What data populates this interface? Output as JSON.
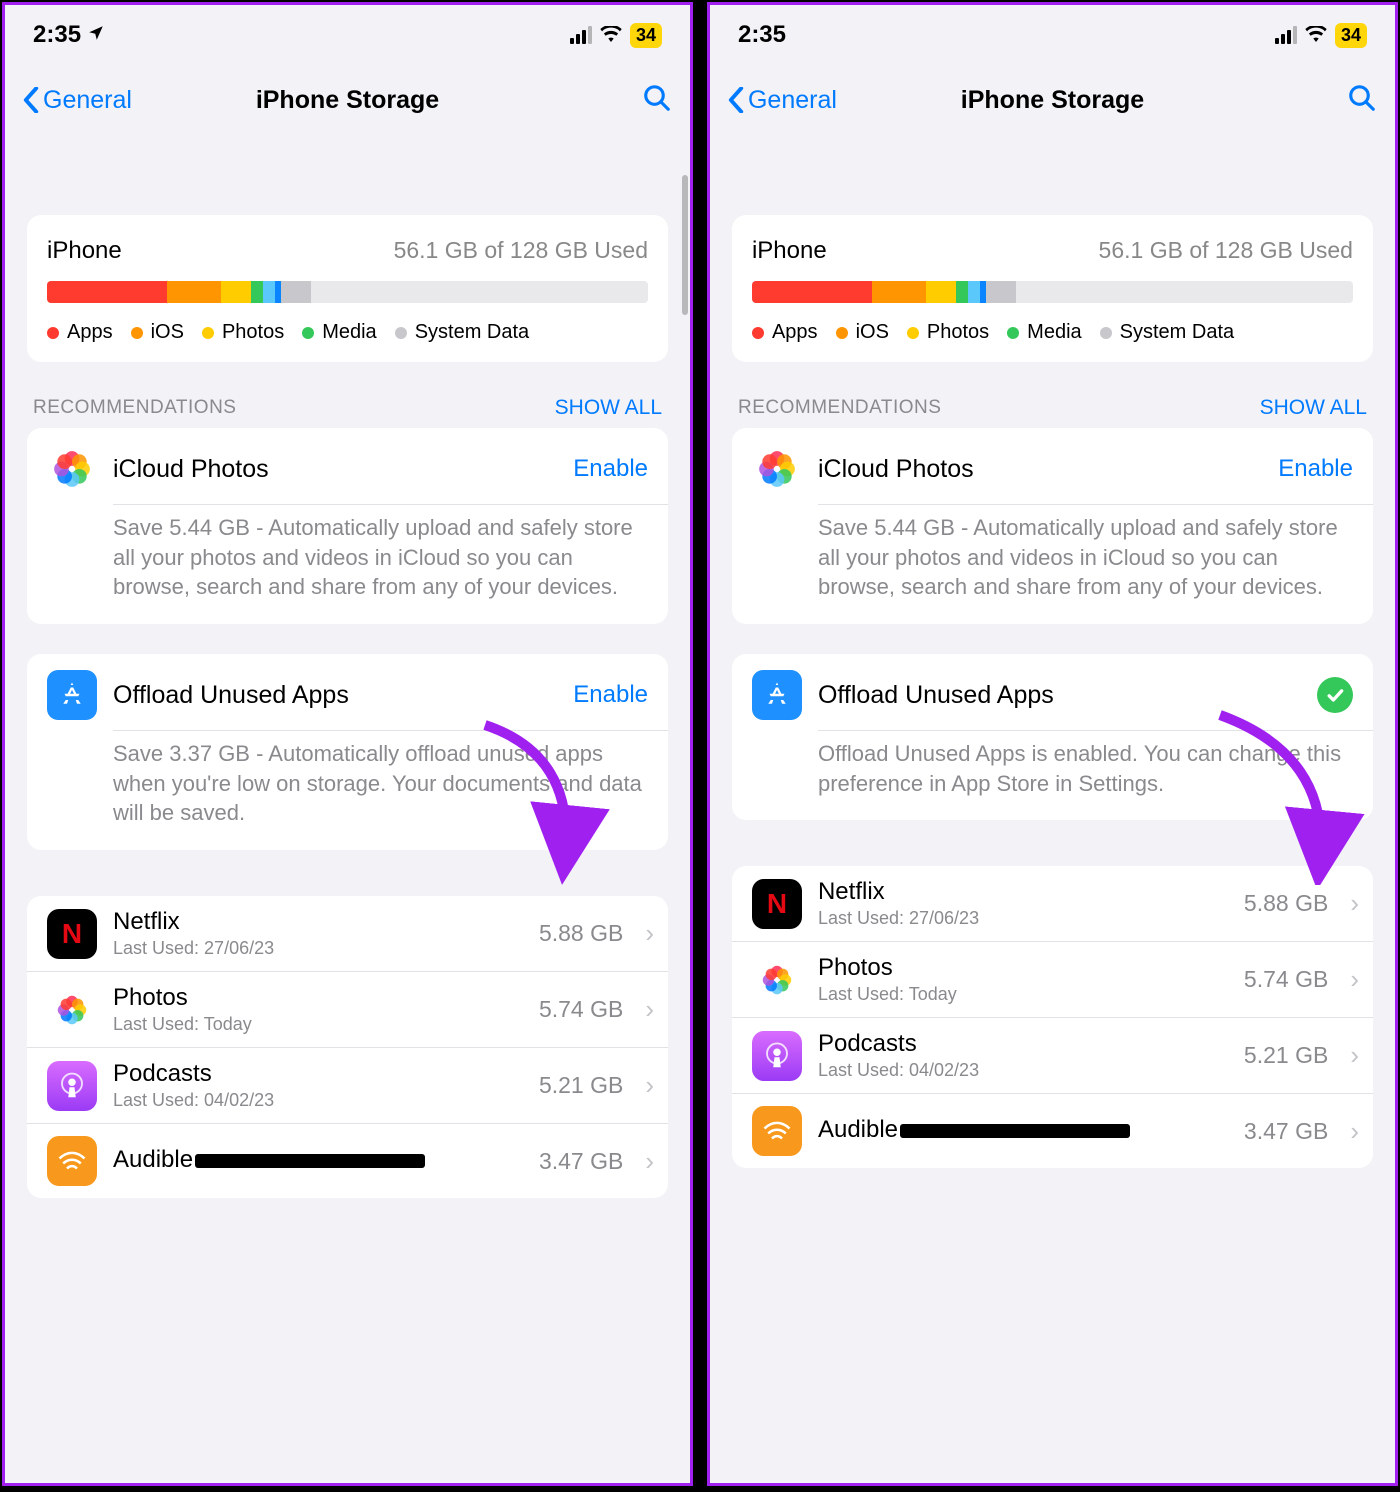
{
  "status": {
    "time_left": "2:35",
    "time_right": "2:35",
    "battery": "34"
  },
  "nav": {
    "back": "General",
    "title": "iPhone Storage"
  },
  "storage": {
    "device": "iPhone",
    "used_text": "56.1 GB of 128 GB Used",
    "segments": [
      {
        "color": "#ff3b30",
        "pct": 20
      },
      {
        "color": "#ff9500",
        "pct": 9
      },
      {
        "color": "#ffcc00",
        "pct": 5
      },
      {
        "color": "#34c759",
        "pct": 2
      },
      {
        "color": "#5ac8fa",
        "pct": 2
      },
      {
        "color": "#0b84ff",
        "pct": 1
      },
      {
        "color": "#c7c7cc",
        "pct": 5
      }
    ],
    "legend": [
      {
        "label": "Apps",
        "color": "#ff3b30"
      },
      {
        "label": "iOS",
        "color": "#ff9500"
      },
      {
        "label": "Photos",
        "color": "#ffcc00"
      },
      {
        "label": "Media",
        "color": "#34c759"
      },
      {
        "label": "System Data",
        "color": "#c7c7cc"
      }
    ]
  },
  "recommendations": {
    "header": "RECOMMENDATIONS",
    "show_all": "SHOW ALL",
    "icloud": {
      "title": "iCloud Photos",
      "action": "Enable",
      "desc": "Save 5.44 GB - Automatically upload and safely store all your photos and videos in iCloud so you can browse, search and share from any of your devices."
    },
    "offload_left": {
      "title": "Offload Unused Apps",
      "action": "Enable",
      "desc": "Save 3.37 GB - Automatically offload unused apps when you're low on storage. Your documents and data will be saved."
    },
    "offload_right": {
      "title": "Offload Unused Apps",
      "desc": "Offload Unused Apps is enabled. You can change this preference in App Store in Settings."
    }
  },
  "apps": [
    {
      "name": "Netflix",
      "sub": "Last Used: 27/06/23",
      "size": "5.88 GB",
      "icon": "netflix"
    },
    {
      "name": "Photos",
      "sub": "Last Used: Today",
      "size": "5.74 GB",
      "icon": "photos"
    },
    {
      "name": "Podcasts",
      "sub": "Last Used: 04/02/23",
      "size": "5.21 GB",
      "icon": "podcasts"
    },
    {
      "name": "Audible",
      "sub": "",
      "size": "3.47 GB",
      "icon": "audible"
    }
  ]
}
